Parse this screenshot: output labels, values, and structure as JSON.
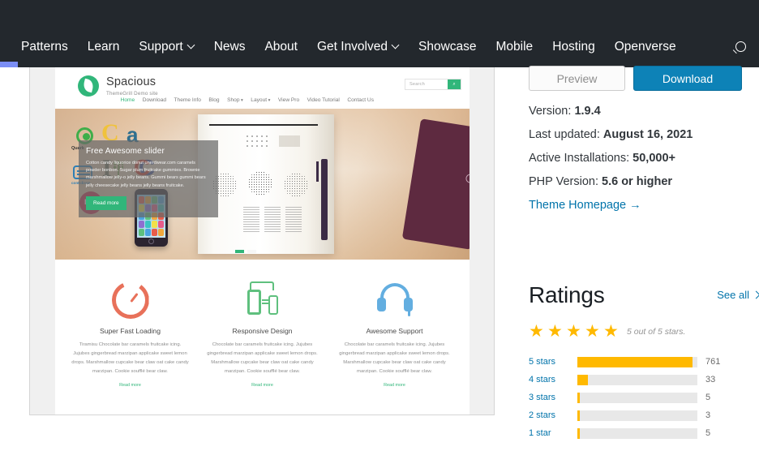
{
  "header": {
    "nav_items": [
      {
        "label": "Patterns",
        "caret": false
      },
      {
        "label": "Learn",
        "caret": false
      },
      {
        "label": "Support",
        "caret": true
      },
      {
        "label": "News",
        "caret": false
      },
      {
        "label": "About",
        "caret": false
      },
      {
        "label": "Get Involved",
        "caret": true
      },
      {
        "label": "Showcase",
        "caret": false
      },
      {
        "label": "Mobile",
        "caret": false
      },
      {
        "label": "Hosting",
        "caret": false
      },
      {
        "label": "Openverse",
        "caret": false
      }
    ],
    "search_icon": "search-icon",
    "background_color": "#23282d",
    "progress_color": "#7b8ef5"
  },
  "theme_preview": {
    "site_name": "Spacious",
    "site_tagline": "ThemeGrill Demo site",
    "nav": [
      "Home",
      "Download",
      "Theme Info",
      "Blog",
      "Shop",
      "Layout",
      "View Pro",
      "Video Tutorial",
      "Contact Us"
    ],
    "nav_active": "Home",
    "nav_with_caret": [
      "Shop",
      "Layout"
    ],
    "search_placeholder": "Search",
    "search_button_icon": "search-icon",
    "accent_color": "#31b67a",
    "slider": {
      "title": "Free Awesome slider",
      "text": "Cotton candy liquorice donut unerdwear.com caramels powder bonbon. Sugar plum fruitcake gummies. Brownie marshmallow jelly-o jelly beans. Gummi bears gummi bears jelly cheesecake jelly beans jelly beans fruitcake.",
      "button": "Read more",
      "dots": [
        "active",
        "inactive"
      ]
    },
    "features": [
      {
        "icon": "speed-gauge-icon",
        "title": "Super Fast Loading",
        "text": "Tiramisu Chocolate bar caramels fruitcake icing. Jujubes gingerbread marzipan applicake sweet lemon drops. Marshmallow cupcake bear claw oat cake candy marzipan. Cookie soufflé bear claw.",
        "more": "Read more"
      },
      {
        "icon": "responsive-devices-icon",
        "title": "Responsive Design",
        "text": "Chocolate bar caramels fruitcake icing. Jujubes gingerbread marzipan applicake sweet lemon drops. Marshmallow cupcake bear claw oat cake candy marzipan. Cookie soufflé bear claw.",
        "more": "Read more"
      },
      {
        "icon": "headset-support-icon",
        "title": "Awesome Support",
        "text": "Chocolate bar caramels fruitcake icing. Jujubes gingerbread marzipan applicake sweet lemon drops. Marshmallow cupcake bear claw oat cake candy marzipan. Cookie soufflé bear claw.",
        "more": "Read more"
      }
    ]
  },
  "sidebar": {
    "preview_button": "Preview",
    "download_button": "Download",
    "download_color": "#0d82b7",
    "meta": [
      {
        "label": "Version:",
        "value": "1.9.4"
      },
      {
        "label": "Last updated:",
        "value": "August 16, 2021"
      },
      {
        "label": "Active Installations:",
        "value": "50,000+"
      },
      {
        "label": "PHP Version:",
        "value": "5.6 or higher"
      }
    ],
    "homepage_link": "Theme Homepage →",
    "link_color": "#0073aa"
  },
  "ratings": {
    "title": "Ratings",
    "see_all": "See all",
    "see_all_icon": "chevron-right-icon",
    "stars_filled": 5,
    "stars_total": 5,
    "summary": "5 out of 5 stars.",
    "star_color": "#ffb900",
    "breakdown": [
      {
        "label": "5 stars",
        "count": "761",
        "percent": 96
      },
      {
        "label": "4 stars",
        "count": "33",
        "percent": 9
      },
      {
        "label": "3 stars",
        "count": "5",
        "percent": 2
      },
      {
        "label": "2 stars",
        "count": "3",
        "percent": 2
      },
      {
        "label": "1 star",
        "count": "5",
        "percent": 2
      }
    ]
  }
}
